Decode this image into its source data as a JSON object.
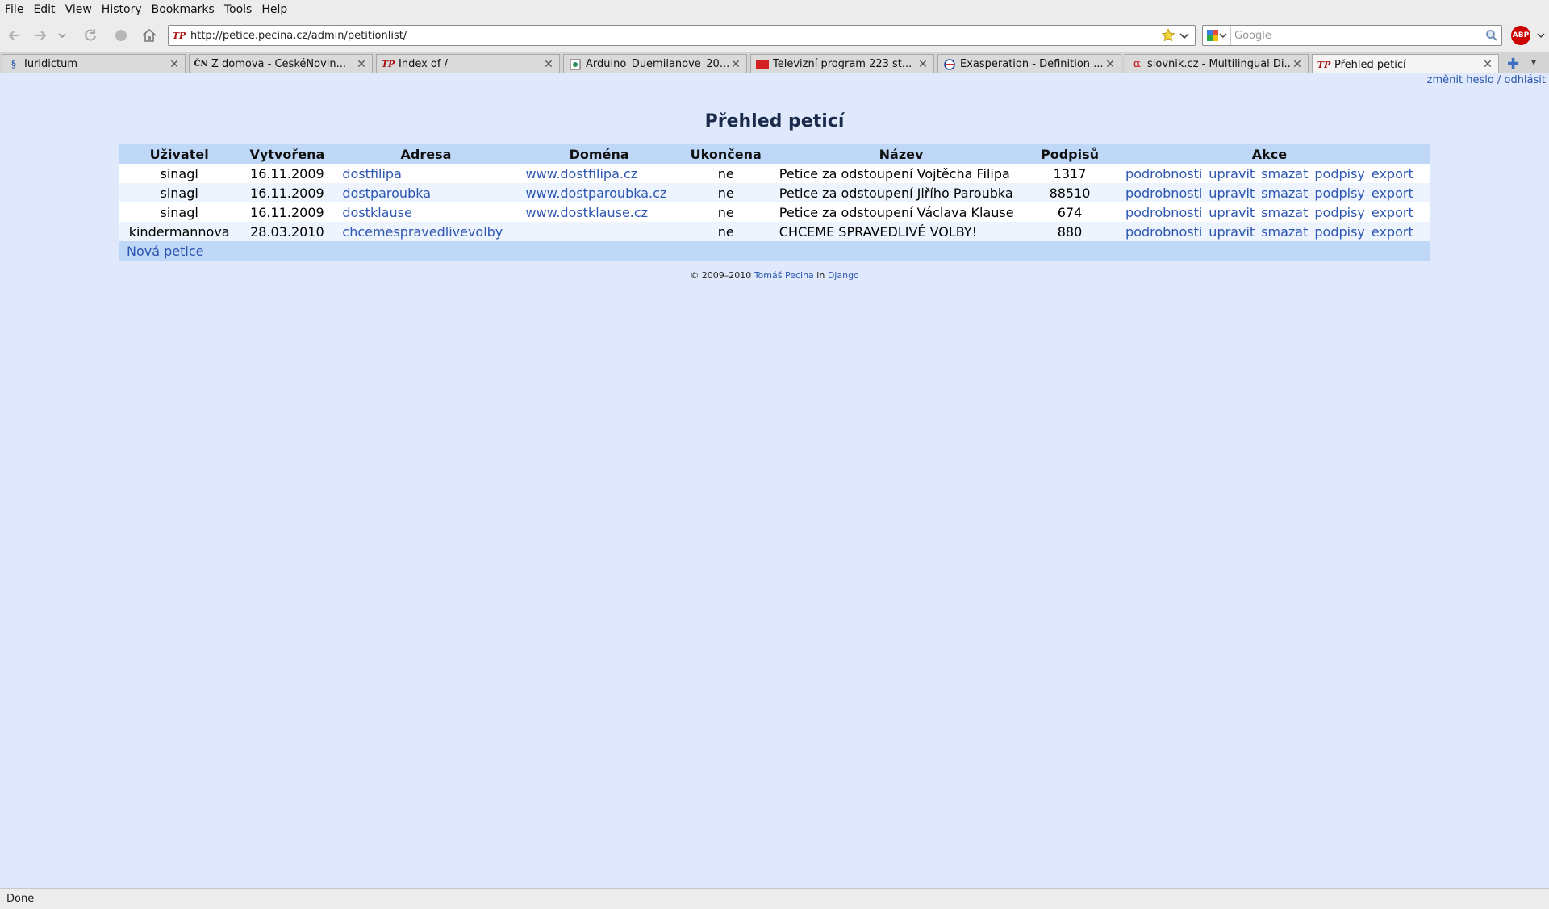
{
  "browser": {
    "menu": [
      "File",
      "Edit",
      "View",
      "History",
      "Bookmarks",
      "Tools",
      "Help"
    ],
    "url": "http://petice.pecina.cz/admin/petitionlist/",
    "search_placeholder": "Google",
    "abp_label": "ABP",
    "tabs": [
      {
        "label": "Iuridictum",
        "favicon": "iuridictum-favicon",
        "active": false
      },
      {
        "label": "Z domova - ČeskéNovin...",
        "favicon": "ceskenoviny-favicon",
        "active": false
      },
      {
        "label": "Index of /",
        "favicon": "tp-favicon",
        "active": false
      },
      {
        "label": "Arduino_Duemilanove_20...",
        "favicon": "image-favicon",
        "active": false
      },
      {
        "label": "Televizní program 223 st...",
        "favicon": "tv-favicon",
        "active": false
      },
      {
        "label": "Exasperation - Definition ...",
        "favicon": "dictionary-favicon",
        "active": false
      },
      {
        "label": "slovnik.cz - Multilingual Di...",
        "favicon": "slovnik-favicon",
        "active": false
      },
      {
        "label": "Přehled peticí",
        "favicon": "tp-favicon",
        "active": true
      }
    ],
    "status": "Done"
  },
  "page": {
    "userbar": {
      "change_password": "změnit heslo",
      "separator": " / ",
      "logout": "odhlásit"
    },
    "title": "Přehled peticí",
    "columns": [
      "Uživatel",
      "Vytvořena",
      "Adresa",
      "Doména",
      "Ukončena",
      "Název",
      "Podpisů",
      "Akce"
    ],
    "rows": [
      {
        "user": "sinagl",
        "created": "16.11.2009",
        "address": "dostfilipa",
        "domain": "www.dostfilipa.cz",
        "closed": "ne",
        "name": "Petice za odstoupení Vojtěcha Filipa",
        "signatures": "1317"
      },
      {
        "user": "sinagl",
        "created": "16.11.2009",
        "address": "dostparoubka",
        "domain": "www.dostparoubka.cz",
        "closed": "ne",
        "name": "Petice za odstoupení Jiřího Paroubka",
        "signatures": "88510"
      },
      {
        "user": "sinagl",
        "created": "16.11.2009",
        "address": "dostklause",
        "domain": "www.dostklause.cz",
        "closed": "ne",
        "name": "Petice za odstoupení Václava Klause",
        "signatures": "674"
      },
      {
        "user": "kindermannova",
        "created": "28.03.2010",
        "address": "chcemespravedlivevolby",
        "domain": "",
        "closed": "ne",
        "name": "CHCEME SPRAVEDLIVÉ VOLBY!",
        "signatures": "880"
      }
    ],
    "actions": [
      "podrobnosti",
      "upravit",
      "smazat",
      "podpisy",
      "export"
    ],
    "new_petition": "Nová petice",
    "footer": {
      "copyright": "© 2009–2010 ",
      "author": "Tomáš Pecina",
      "in": " in ",
      "framework": "Django"
    }
  }
}
